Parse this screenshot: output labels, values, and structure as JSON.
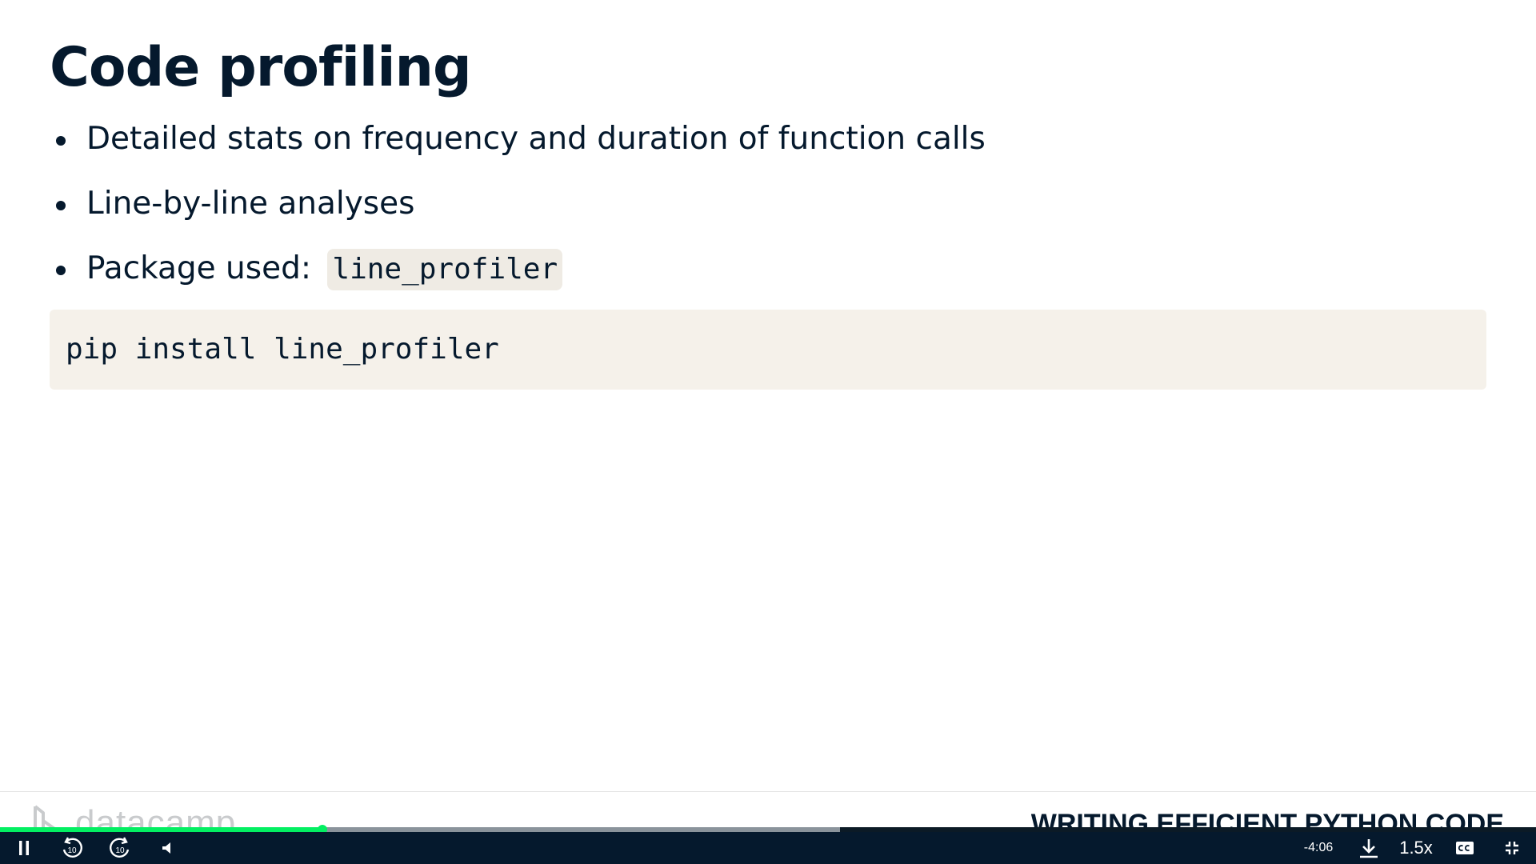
{
  "slide": {
    "title": "Code profiling",
    "bullets": [
      {
        "text": "Detailed stats on frequency and duration of function calls"
      },
      {
        "text": "Line-by-line analyses"
      },
      {
        "text": "Package used:",
        "code": "line_profiler"
      }
    ],
    "code_block": "pip install line_profiler"
  },
  "footer": {
    "logo_text": "datacamp",
    "course_title": "WRITING EFFICIENT PYTHON CODE"
  },
  "player": {
    "played_fraction": 0.21,
    "buffered_fraction": 0.547,
    "time_remaining": "-4:06",
    "speed": "1.5x",
    "skip_seconds": "10",
    "controls": {
      "pause": "pause-icon",
      "rewind": "rewind-10-icon",
      "forward": "forward-10-icon",
      "volume": "volume-icon",
      "download": "download-icon",
      "captions": "captions-icon",
      "exit_fullscreen": "exit-fullscreen-icon"
    },
    "colors": {
      "accent": "#03ef62",
      "bar": "#05192d",
      "buffered": "#8a939b"
    }
  }
}
